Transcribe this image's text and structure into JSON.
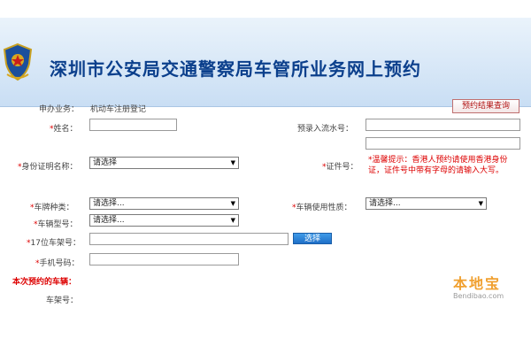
{
  "header": {
    "title": "深圳市公安局交通警察局车管所业务网上预约"
  },
  "form": {
    "business_label": "申办业务：",
    "business_value": "机动车注册登记",
    "query_button": "预约结果查询",
    "name_label": "姓名：",
    "serial_label": "预录入流水号：",
    "id_type_label": "身份证明名称：",
    "id_type_value": "请选择",
    "cert_no_label": "证件号：",
    "hint": "*温馨提示：香港人预约请使用香港身份证，证件号中带有字母的请输入大写。",
    "plate_type_label": "车牌种类：",
    "plate_type_value": "请选择...",
    "usage_label": "车辆使用性质：",
    "usage_value": "请选择...",
    "vehicle_model_label": "车辆型号：",
    "vehicle_model_value": "请选择...",
    "vin_label": "17位车架号：",
    "select_button": "选择",
    "phone_label": "手机号码：",
    "section_title": "本次预约的车辆：",
    "frame_no_label": "车架号："
  },
  "required_mark": "*",
  "watermark": {
    "name": "本地宝",
    "url": "Bendibao.com"
  },
  "icons": {
    "emblem": "police-emblem-icon",
    "dropdown": "chevron-down-icon"
  },
  "colors": {
    "title": "#0b3f8c",
    "required": "#dd0000",
    "select_button": "#1f6fc7"
  }
}
